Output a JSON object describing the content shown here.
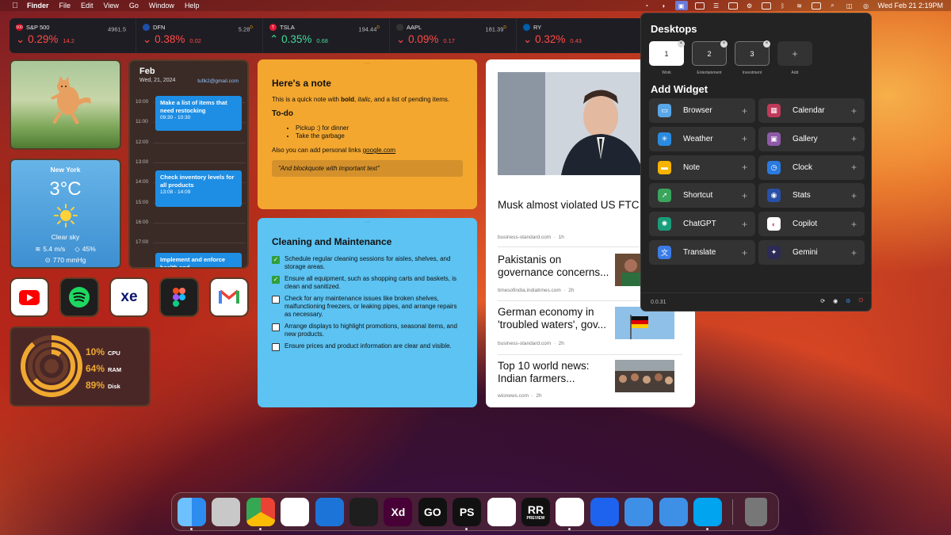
{
  "menubar": {
    "apple": "",
    "items": [
      "Finder",
      "File",
      "Edit",
      "View",
      "Go",
      "Window",
      "Help"
    ],
    "clock": "Wed Feb 21  2:19PM"
  },
  "ticker": [
    {
      "symbol": "S&P 500",
      "logo_text": "500",
      "logo_color": "#d0021b",
      "price": "4961.5",
      "price_suffix": "",
      "change": "0.29%",
      "delta": "14.2",
      "direction": "down"
    },
    {
      "symbol": "DFN",
      "logo_text": "",
      "logo_color": "#1e4fa8",
      "price": "5.28",
      "price_suffix": "D",
      "change": "0.38%",
      "delta": "0.02",
      "direction": "down"
    },
    {
      "symbol": "TSLA",
      "logo_text": "T",
      "logo_color": "#e31937",
      "price": "194.44",
      "price_suffix": "D",
      "change": "0.35%",
      "delta": "0.68",
      "direction": "up"
    },
    {
      "symbol": "AAPL",
      "logo_text": "",
      "logo_color": "#333333",
      "price": "181.39",
      "price_suffix": "D",
      "change": "0.09%",
      "delta": "0.17",
      "direction": "down"
    },
    {
      "symbol": "RY",
      "logo_text": "",
      "logo_color": "#005daa",
      "price": "",
      "price_suffix": "",
      "change": "0.32%",
      "delta": "0.43",
      "direction": "down"
    }
  ],
  "weather": {
    "city": "New York",
    "temp": "3°C",
    "desc": "Clear sky",
    "wind": "5.4 m/s",
    "humidity": "45%",
    "pressure": "770 mmHg"
  },
  "calendar": {
    "month": "Feb",
    "date": "Wed, 21, 2024",
    "email": "tufik2@gmail.com",
    "times": [
      "10:00",
      "11:00",
      "12:00",
      "13:00",
      "14:00",
      "15:00",
      "16:00",
      "17:00"
    ],
    "events": [
      {
        "title": "Make a list of items that need restocking",
        "time": "09:30 - 10:30"
      },
      {
        "title": "Check inventory levels for all products",
        "time": "13:08 - 14:09"
      },
      {
        "title": "Implement and enforce health and",
        "time": ""
      }
    ]
  },
  "apps": [
    {
      "name": "youtube",
      "bg": "#ffffff"
    },
    {
      "name": "spotify",
      "bg": "#1e1e1e"
    },
    {
      "name": "xe",
      "bg": "#ffffff",
      "text": "xe"
    },
    {
      "name": "figma",
      "bg": "#1e1e1e"
    },
    {
      "name": "gmail",
      "bg": "#ffffff"
    }
  ],
  "stats": {
    "cpu_pct": "10%",
    "cpu_label": "CPU",
    "ram_pct": "64%",
    "ram_label": "RAM",
    "disk_pct": "89%",
    "disk_label": "Disk",
    "cpu_value": 0.1,
    "ram_value": 0.64,
    "disk_value": 0.89,
    "accent": "#f0a930"
  },
  "note": {
    "title": "Here's a note",
    "intro_a": "This is a quick note with ",
    "intro_bold": "bold",
    "intro_b": ", ",
    "intro_italic": "italic",
    "intro_c": ", and a list of pending items.",
    "todo_heading": "To-do",
    "todo": [
      "Pickup :) for dinner",
      "Take the garbage"
    ],
    "links_text": "Also you can add personal links ",
    "link": "google.com",
    "quote": "\"And blockquote with important text\""
  },
  "cleaning": {
    "title": "Cleaning and Maintenance",
    "items": [
      {
        "text": "Schedule regular cleaning sessions for aisles, shelves, and storage areas.",
        "done": true
      },
      {
        "text": "Ensure all equipment, such as shopping carts and baskets, is clean and sanitized.",
        "done": true
      },
      {
        "text": "Check for any maintenance issues like broken shelves, malfunctioning freezers, or leaking pipes, and arrange repairs as necessary.",
        "done": false
      },
      {
        "text": "Arrange displays to highlight promotions, seasonal items, and new products.",
        "done": false
      },
      {
        "text": "Ensure prices and product information are clear and visible.",
        "done": false
      }
    ]
  },
  "news": {
    "items": [
      {
        "title": "Musk almost violated US FTC privacy order before Twitter s",
        "source": "business-standard.com",
        "age": "1h"
      },
      {
        "title": "Pakistanis on governance concerns...",
        "source": "timesofindia.indiatimes.com",
        "age": "2h"
      },
      {
        "title": "German economy in 'troubled waters', gov...",
        "source": "business-standard.com",
        "age": "2h"
      },
      {
        "title": "Top 10 world news: Indian farmers...",
        "source": "wionews.com",
        "age": "2h"
      }
    ]
  },
  "popover": {
    "desktops_title": "Desktops",
    "desktops": [
      {
        "num": "1",
        "label": "Work",
        "active": true
      },
      {
        "num": "2",
        "label": "Entertainment",
        "active": false
      },
      {
        "num": "3",
        "label": "Investment",
        "active": false
      }
    ],
    "add_label": "Add",
    "add_symbol": "+",
    "close_symbol": "×",
    "widget_title": "Add Widget",
    "widgets": [
      {
        "label": "Browser",
        "color": "#5aa7e8",
        "glyph": "▭"
      },
      {
        "label": "Calendar",
        "color": "#c0395a",
        "glyph": "▦"
      },
      {
        "label": "Weather",
        "color": "#2a8be0",
        "glyph": "✳"
      },
      {
        "label": "Gallery",
        "color": "#8e5aa8",
        "glyph": "▣"
      },
      {
        "label": "Note",
        "color": "#f5b400",
        "glyph": "▬"
      },
      {
        "label": "Clock",
        "color": "#2a7be0",
        "glyph": "◷"
      },
      {
        "label": "Shortcut",
        "color": "#3aa55d",
        "glyph": "➚"
      },
      {
        "label": "Stats",
        "color": "#2850a8",
        "glyph": "◉"
      },
      {
        "label": "ChatGPT",
        "color": "#1a9d7a",
        "glyph": "✺"
      },
      {
        "label": "Copilot",
        "color": "#ffffff",
        "glyph": "◐"
      },
      {
        "label": "Translate",
        "color": "#3b7be6",
        "glyph": "文"
      },
      {
        "label": "Gemini",
        "color": "#2b2b55",
        "glyph": "✦"
      }
    ],
    "plus": "+",
    "version": "0.0.31"
  },
  "dock": [
    {
      "name": "finder",
      "bg": "#2d8cf0",
      "text": ""
    },
    {
      "name": "launchpad",
      "bg": "#c8c8c8",
      "text": ""
    },
    {
      "name": "chrome",
      "bg": "#ffffff",
      "text": ""
    },
    {
      "name": "slack",
      "bg": "#ffffff",
      "text": ""
    },
    {
      "name": "sourcetree",
      "bg": "#1d74d8",
      "text": ""
    },
    {
      "name": "figma",
      "bg": "#1e1e1e",
      "text": ""
    },
    {
      "name": "adobe-xd",
      "bg": "#470137",
      "text": "Xd"
    },
    {
      "name": "goland",
      "bg": "#111111",
      "text": "GO"
    },
    {
      "name": "phpstorm",
      "bg": "#111111",
      "text": "PS"
    },
    {
      "name": "1password",
      "bg": "#ffffff",
      "text": ""
    },
    {
      "name": "rustrover",
      "bg": "#111111",
      "text": "RR"
    },
    {
      "name": "vscode",
      "bg": "#ffffff",
      "text": ""
    },
    {
      "name": "docker",
      "bg": "#1d63ed",
      "text": ""
    },
    {
      "name": "xcode",
      "bg": "#3e8fe6",
      "text": ""
    },
    {
      "name": "simulator",
      "bg": "#3e8fe6",
      "text": ""
    },
    {
      "name": "windows",
      "bg": "#00a4ef",
      "text": ""
    },
    {
      "name": "trash",
      "bg": "#777777",
      "text": ""
    }
  ],
  "dock_preview_label": "PREVIEW"
}
